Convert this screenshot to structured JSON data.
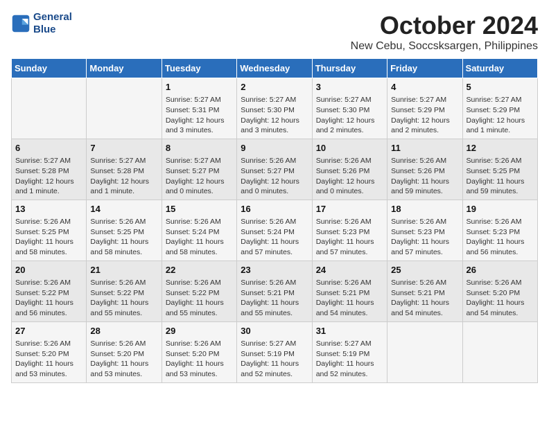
{
  "header": {
    "logo_line1": "General",
    "logo_line2": "Blue",
    "month": "October 2024",
    "location": "New Cebu, Soccsksargen, Philippines"
  },
  "days_of_week": [
    "Sunday",
    "Monday",
    "Tuesday",
    "Wednesday",
    "Thursday",
    "Friday",
    "Saturday"
  ],
  "weeks": [
    [
      {
        "day": "",
        "content": ""
      },
      {
        "day": "",
        "content": ""
      },
      {
        "day": "1",
        "content": "Sunrise: 5:27 AM\nSunset: 5:31 PM\nDaylight: 12 hours and 3 minutes."
      },
      {
        "day": "2",
        "content": "Sunrise: 5:27 AM\nSunset: 5:30 PM\nDaylight: 12 hours and 3 minutes."
      },
      {
        "day": "3",
        "content": "Sunrise: 5:27 AM\nSunset: 5:30 PM\nDaylight: 12 hours and 2 minutes."
      },
      {
        "day": "4",
        "content": "Sunrise: 5:27 AM\nSunset: 5:29 PM\nDaylight: 12 hours and 2 minutes."
      },
      {
        "day": "5",
        "content": "Sunrise: 5:27 AM\nSunset: 5:29 PM\nDaylight: 12 hours and 1 minute."
      }
    ],
    [
      {
        "day": "6",
        "content": "Sunrise: 5:27 AM\nSunset: 5:28 PM\nDaylight: 12 hours and 1 minute."
      },
      {
        "day": "7",
        "content": "Sunrise: 5:27 AM\nSunset: 5:28 PM\nDaylight: 12 hours and 1 minute."
      },
      {
        "day": "8",
        "content": "Sunrise: 5:27 AM\nSunset: 5:27 PM\nDaylight: 12 hours and 0 minutes."
      },
      {
        "day": "9",
        "content": "Sunrise: 5:26 AM\nSunset: 5:27 PM\nDaylight: 12 hours and 0 minutes."
      },
      {
        "day": "10",
        "content": "Sunrise: 5:26 AM\nSunset: 5:26 PM\nDaylight: 12 hours and 0 minutes."
      },
      {
        "day": "11",
        "content": "Sunrise: 5:26 AM\nSunset: 5:26 PM\nDaylight: 11 hours and 59 minutes."
      },
      {
        "day": "12",
        "content": "Sunrise: 5:26 AM\nSunset: 5:25 PM\nDaylight: 11 hours and 59 minutes."
      }
    ],
    [
      {
        "day": "13",
        "content": "Sunrise: 5:26 AM\nSunset: 5:25 PM\nDaylight: 11 hours and 58 minutes."
      },
      {
        "day": "14",
        "content": "Sunrise: 5:26 AM\nSunset: 5:25 PM\nDaylight: 11 hours and 58 minutes."
      },
      {
        "day": "15",
        "content": "Sunrise: 5:26 AM\nSunset: 5:24 PM\nDaylight: 11 hours and 58 minutes."
      },
      {
        "day": "16",
        "content": "Sunrise: 5:26 AM\nSunset: 5:24 PM\nDaylight: 11 hours and 57 minutes."
      },
      {
        "day": "17",
        "content": "Sunrise: 5:26 AM\nSunset: 5:23 PM\nDaylight: 11 hours and 57 minutes."
      },
      {
        "day": "18",
        "content": "Sunrise: 5:26 AM\nSunset: 5:23 PM\nDaylight: 11 hours and 57 minutes."
      },
      {
        "day": "19",
        "content": "Sunrise: 5:26 AM\nSunset: 5:23 PM\nDaylight: 11 hours and 56 minutes."
      }
    ],
    [
      {
        "day": "20",
        "content": "Sunrise: 5:26 AM\nSunset: 5:22 PM\nDaylight: 11 hours and 56 minutes."
      },
      {
        "day": "21",
        "content": "Sunrise: 5:26 AM\nSunset: 5:22 PM\nDaylight: 11 hours and 55 minutes."
      },
      {
        "day": "22",
        "content": "Sunrise: 5:26 AM\nSunset: 5:22 PM\nDaylight: 11 hours and 55 minutes."
      },
      {
        "day": "23",
        "content": "Sunrise: 5:26 AM\nSunset: 5:21 PM\nDaylight: 11 hours and 55 minutes."
      },
      {
        "day": "24",
        "content": "Sunrise: 5:26 AM\nSunset: 5:21 PM\nDaylight: 11 hours and 54 minutes."
      },
      {
        "day": "25",
        "content": "Sunrise: 5:26 AM\nSunset: 5:21 PM\nDaylight: 11 hours and 54 minutes."
      },
      {
        "day": "26",
        "content": "Sunrise: 5:26 AM\nSunset: 5:20 PM\nDaylight: 11 hours and 54 minutes."
      }
    ],
    [
      {
        "day": "27",
        "content": "Sunrise: 5:26 AM\nSunset: 5:20 PM\nDaylight: 11 hours and 53 minutes."
      },
      {
        "day": "28",
        "content": "Sunrise: 5:26 AM\nSunset: 5:20 PM\nDaylight: 11 hours and 53 minutes."
      },
      {
        "day": "29",
        "content": "Sunrise: 5:26 AM\nSunset: 5:20 PM\nDaylight: 11 hours and 53 minutes."
      },
      {
        "day": "30",
        "content": "Sunrise: 5:27 AM\nSunset: 5:19 PM\nDaylight: 11 hours and 52 minutes."
      },
      {
        "day": "31",
        "content": "Sunrise: 5:27 AM\nSunset: 5:19 PM\nDaylight: 11 hours and 52 minutes."
      },
      {
        "day": "",
        "content": ""
      },
      {
        "day": "",
        "content": ""
      }
    ]
  ]
}
